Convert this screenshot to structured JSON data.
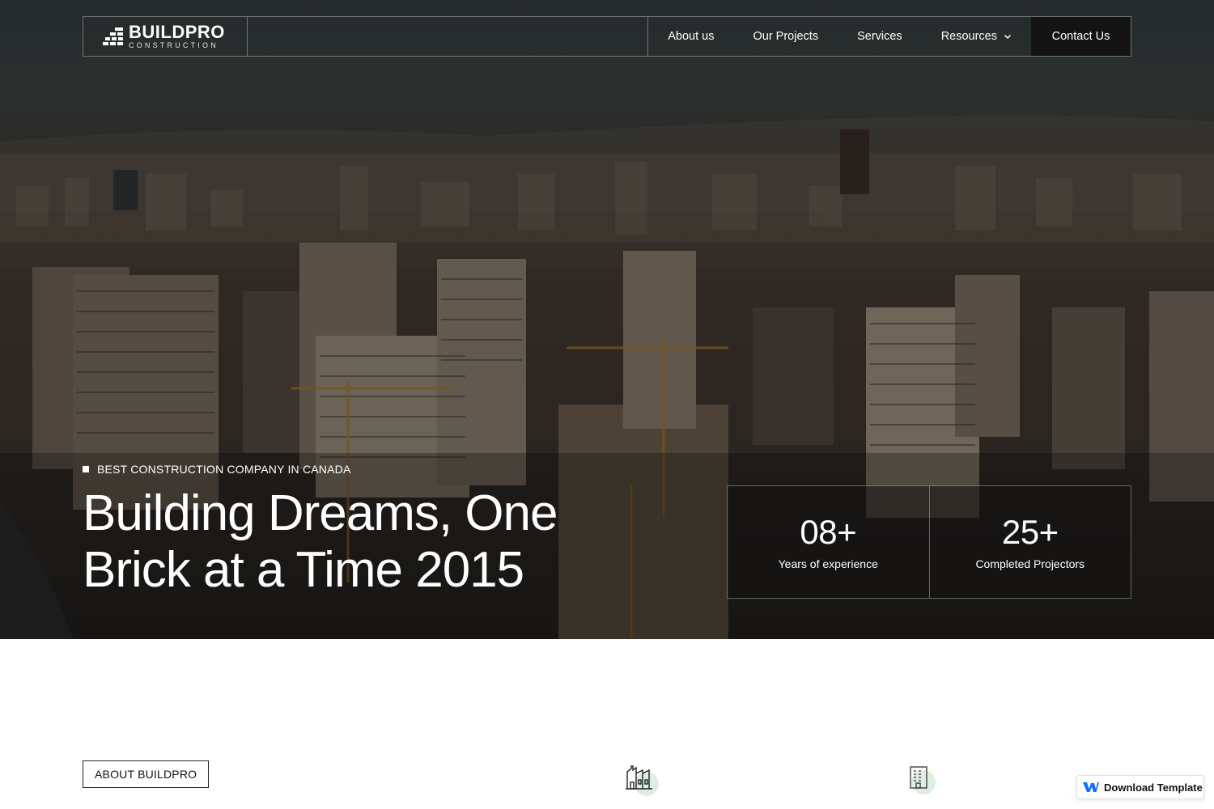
{
  "brand": {
    "name": "BUILDPRO",
    "tagline": "CONSTRUCTION"
  },
  "nav": {
    "links": [
      "About us",
      "Our Projects",
      "Services",
      "Resources"
    ],
    "contact_label": "Contact Us"
  },
  "hero": {
    "eyebrow": "BEST CONSTRUCTION COMPANY IN CANADA",
    "headline_line1": "Building Dreams, One",
    "headline_line2": "Brick at a Time 2015"
  },
  "stats": [
    {
      "value": "08+",
      "label": "Years of experience"
    },
    {
      "value": "25+",
      "label": "Completed Projectors"
    }
  ],
  "about": {
    "tag": "ABOUT BUILDPRO"
  },
  "download": {
    "label": "Download Template"
  },
  "colors": {
    "accent_dark": "#141414",
    "icon_blob": "#dfeee0",
    "webflow_blue": "#146ef5"
  }
}
